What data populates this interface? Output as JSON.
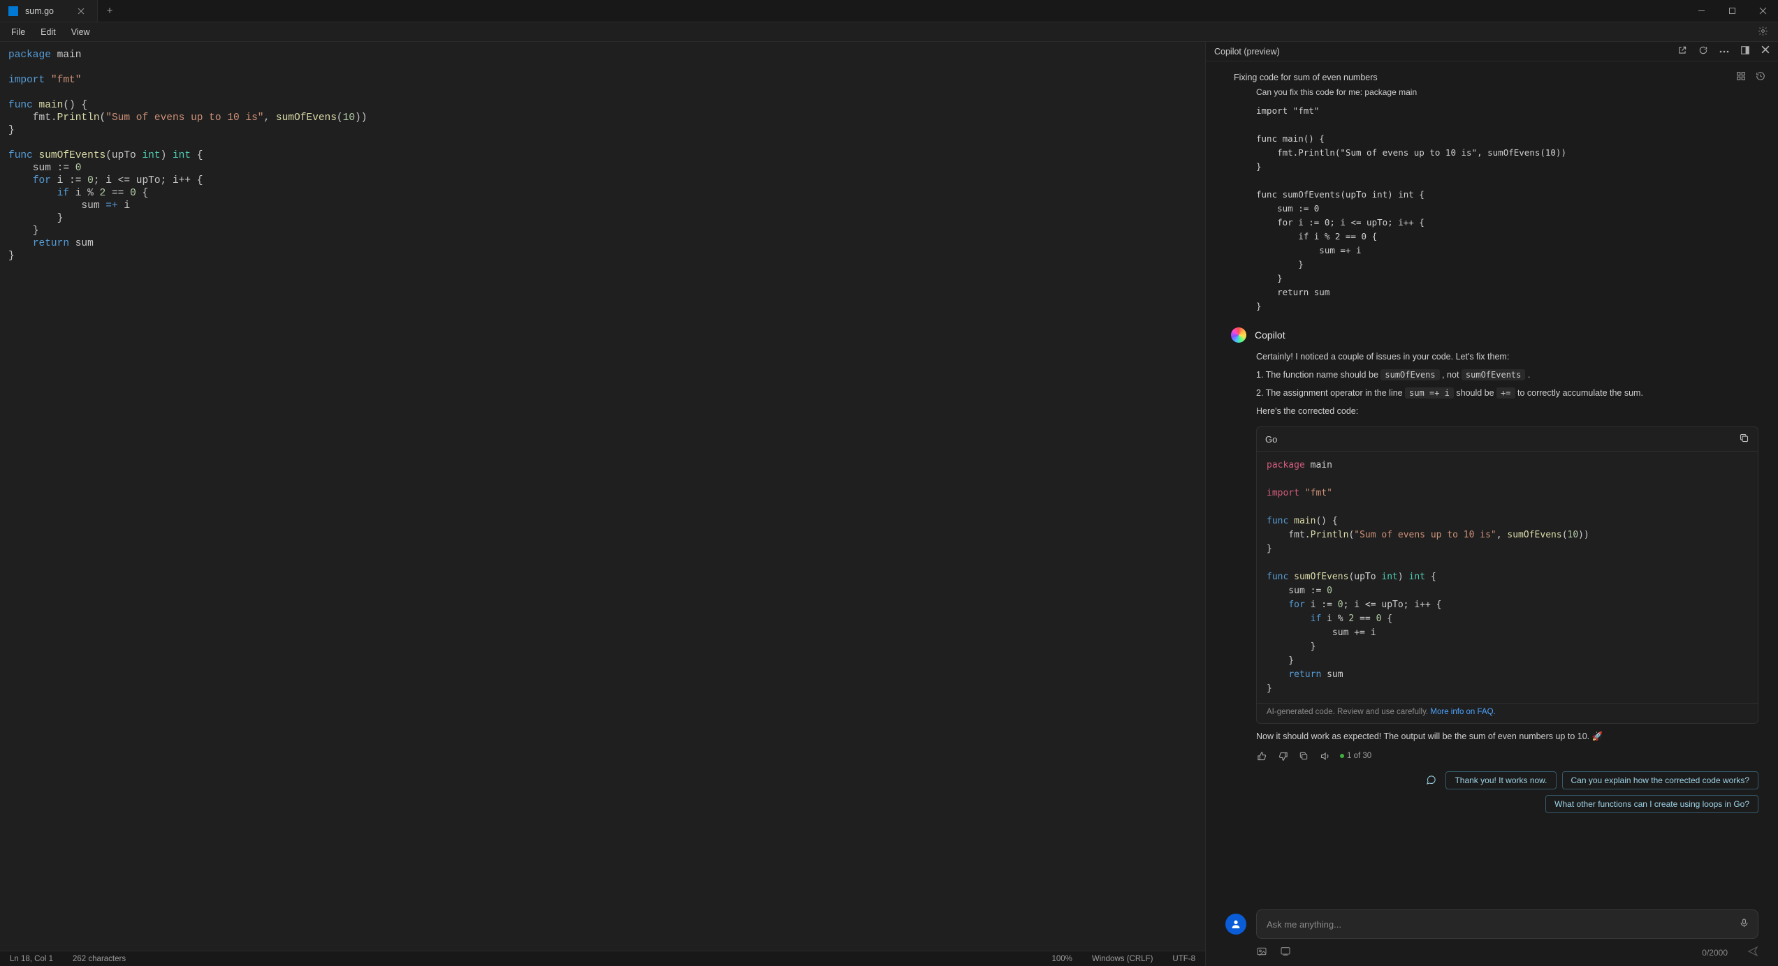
{
  "tab": {
    "title": "sum.go"
  },
  "menu": {
    "file": "File",
    "edit": "Edit",
    "view": "View"
  },
  "editor": {
    "code_lines": [
      "package main",
      "",
      "import \"fmt\"",
      "",
      "func main() {",
      "    fmt.Println(\"Sum of evens up to 10 is\", sumOfEvens(10))",
      "}",
      "",
      "func sumOfEvents(upTo int) int {",
      "    sum := 0",
      "    for i := 0; i <= upTo; i++ {",
      "        if i % 2 == 0 {",
      "            sum =+ i",
      "        }",
      "    }",
      "    return sum",
      "}"
    ]
  },
  "status": {
    "pos": "Ln 18, Col 1",
    "chars": "262 characters",
    "zoom": "100%",
    "eol": "Windows (CRLF)",
    "enc": "UTF-8"
  },
  "copilot": {
    "title": "Copilot (preview)",
    "thread_title": "Fixing code for sum of even numbers",
    "user_msg_intro": "Can you fix this code for me: package main",
    "user_code": "import \"fmt\"\n\nfunc main() {\n    fmt.Println(\"Sum of evens up to 10 is\", sumOfEvens(10))\n}\n\nfunc sumOfEvents(upTo int) int {\n    sum := 0\n    for i := 0; i <= upTo; i++ {\n        if i % 2 == 0 {\n            sum =+ i\n        }\n    }\n    return sum\n}",
    "assistant_name": "Copilot",
    "assist_p1": "Certainly! I noticed a couple of issues in your code. Let's fix them:",
    "li1_a": "1. The function name should be ",
    "li1_code1": "sumOfEvens",
    "li1_mid": " , not ",
    "li1_code2": "sumOfEvents",
    "li1_end": " .",
    "li2_a": "2. The assignment operator in the line ",
    "li2_code1": "sum =+ i",
    "li2_mid": "  should be ",
    "li2_code2": "+=",
    "li2_end": "  to correctly accumulate the sum.",
    "assist_p2": "Here's the corrected code:",
    "code_lang": "Go",
    "corrected_code": "package main\n\nimport \"fmt\"\n\nfunc main() {\n    fmt.Println(\"Sum of evens up to 10 is\", sumOfEvens(10))\n}\n\nfunc sumOfEvens(upTo int) int {\n    sum := 0\n    for i := 0; i <= upTo; i++ {\n        if i % 2 == 0 {\n            sum += i\n        }\n    }\n    return sum\n}",
    "ai_note_a": "AI-generated code. Review and use carefully. ",
    "ai_note_link": "More info on FAQ.",
    "assist_p3": "Now it should work as expected! The output will be the sum of even numbers up to 10. 🚀",
    "pager": "1 of 30",
    "chips": {
      "c1": "Thank you! It works now.",
      "c2": "Can you explain how the corrected code works?",
      "c3": "What other functions can I create using loops in Go?"
    },
    "input_placeholder": "Ask me anything...",
    "counter": "0/2000"
  }
}
